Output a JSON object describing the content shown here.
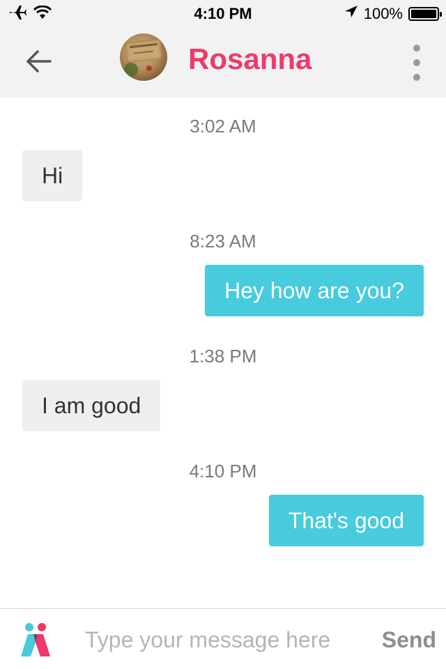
{
  "status_bar": {
    "time": "4:10 PM",
    "battery": "100%",
    "battery_level": 1.0,
    "icons": [
      "airplane-icon",
      "wifi-icon",
      "location-arrow-icon",
      "battery-icon"
    ]
  },
  "header": {
    "contact_name": "Rosanna",
    "name_color": "#ee3a6a",
    "icons": [
      "back-arrow-icon",
      "avatar",
      "more-vertical-icon"
    ]
  },
  "messages": [
    {
      "timestamp": "3:02 AM",
      "direction": "incoming",
      "text": "Hi"
    },
    {
      "timestamp": "8:23 AM",
      "direction": "outgoing",
      "text": "Hey how are you?"
    },
    {
      "timestamp": "1:38 PM",
      "direction": "incoming",
      "text": "I am good"
    },
    {
      "timestamp": "4:10 PM",
      "direction": "outgoing",
      "text": "That's good"
    }
  ],
  "colors": {
    "outgoing_bubble": "#47cbdd",
    "incoming_bubble": "#efefef",
    "header_bg": "#f2f2f2"
  },
  "composer": {
    "placeholder": "Type your message here",
    "value": "",
    "send_label": "Send",
    "logo_icon": "app-logo-icon"
  }
}
